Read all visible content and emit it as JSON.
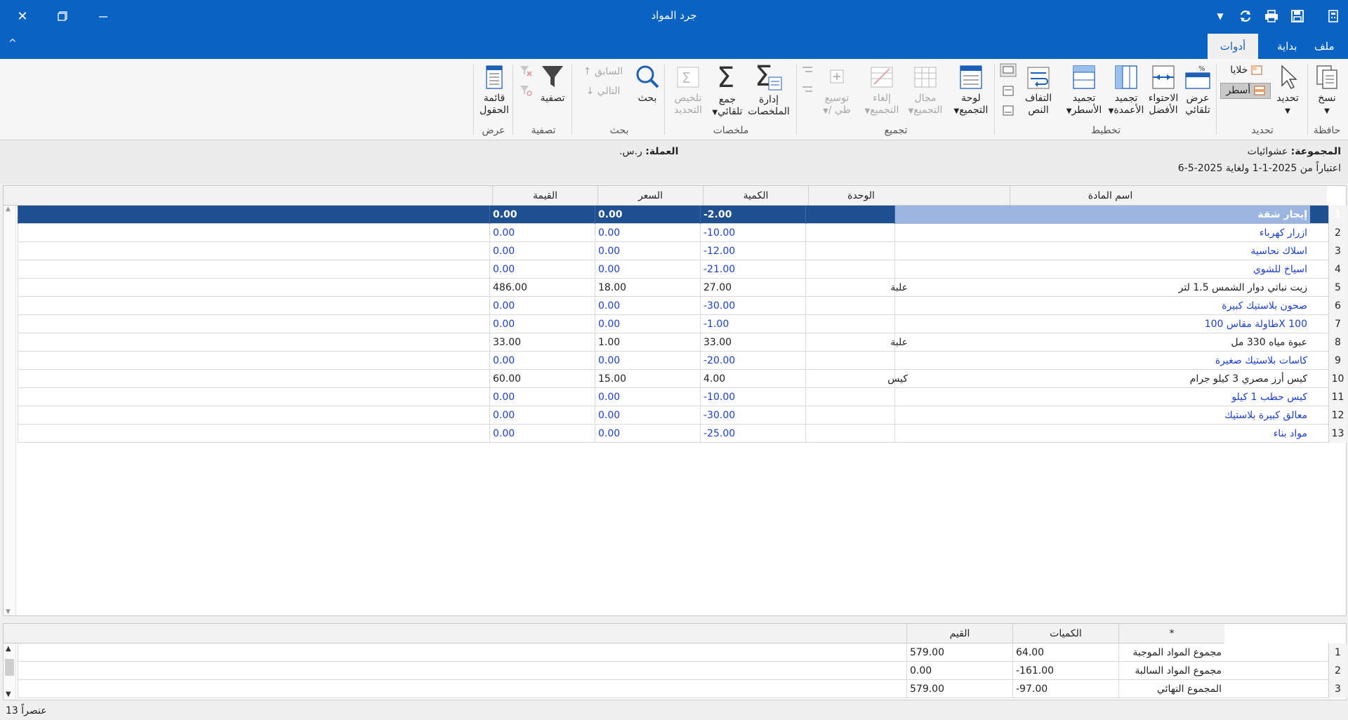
{
  "window": {
    "title": "جرد المواد"
  },
  "tabs": {
    "file": "ملف",
    "home": "بداية",
    "tools": "أدوات"
  },
  "ribbon": {
    "copy": "نسخ",
    "select": "تحديد",
    "cells": "خلايا",
    "rows": "أسطر",
    "auto_width_1": "عرض",
    "auto_width_2": "تلقائي",
    "best_fit_1": "الاحتواء",
    "best_fit_2": "الأفضل",
    "freeze_cols_1": "تجميد",
    "freeze_cols_2": "الأعمدة",
    "freeze_rows_1": "تجميد",
    "freeze_rows_2": "الأسطر",
    "wrap_1": "التفاف",
    "wrap_2": "النص",
    "group_panel_1": "لوحة",
    "group_panel_2": "التجميع",
    "group_range_1": "مجال",
    "group_range_2": "التجميع",
    "ungroup_1": "إلغاء",
    "ungroup_2": "التجميع",
    "expand_1": "توسيع",
    "expand_2": "/ طي",
    "manage_summaries_1": "إدارة",
    "manage_summaries_2": "الملخصات",
    "auto_sum_1": "جمع",
    "auto_sum_2": "تلقائي",
    "summarize_sel_1": "تلخيص",
    "summarize_sel_2": "التحديد",
    "search": "بحث",
    "previous": "السابق",
    "next": "التالي",
    "filter": "تصفية",
    "field_list_1": "قائمة",
    "field_list_2": "الحقول",
    "groups": {
      "clipboard": "حافظة",
      "selection": "تحديد",
      "layout": "تخطيط",
      "grouping": "تجميع",
      "summaries": "ملخصات",
      "search": "بحث",
      "filter": "تصفية",
      "view": "عرض"
    }
  },
  "info": {
    "group_label": "المجموعة:",
    "group_value": "عشوائيات",
    "currency_label": "العملة:",
    "currency_value": "ر.س.",
    "date_range": "اعتباراً من  2025-1-1 ولغاية  2025-5-6"
  },
  "grid": {
    "headers": {
      "name": "اسم المادة",
      "unit": "الوحدة",
      "qty": "الكمية",
      "price": "السعر",
      "value": "القيمة"
    },
    "rows": [
      {
        "n": "1",
        "name": "إيجار شقة",
        "unit": "",
        "qty": "-2.00",
        "price": "0.00",
        "value": "0.00",
        "blue": true
      },
      {
        "n": "2",
        "name": "ازرار كهرباء",
        "unit": "",
        "qty": "-10.00",
        "price": "0.00",
        "value": "0.00",
        "blue": true
      },
      {
        "n": "3",
        "name": "اسلاك نحاسية",
        "unit": "",
        "qty": "-12.00",
        "price": "0.00",
        "value": "0.00",
        "blue": true
      },
      {
        "n": "4",
        "name": "اسياخ للشوي",
        "unit": "",
        "qty": "-21.00",
        "price": "0.00",
        "value": "0.00",
        "blue": true
      },
      {
        "n": "5",
        "name": "زيت نباتي دوار الشمس 1.5 لتر",
        "unit": "علبة",
        "qty": "27.00",
        "price": "18.00",
        "value": "486.00",
        "blue": false
      },
      {
        "n": "6",
        "name": "صحون بلاستيك كبيرة",
        "unit": "",
        "qty": "-30.00",
        "price": "0.00",
        "value": "0.00",
        "blue": true
      },
      {
        "n": "7",
        "name": "طاولة مقاس 100X 100",
        "unit": "",
        "qty": "-1.00",
        "price": "0.00",
        "value": "0.00",
        "blue": true
      },
      {
        "n": "8",
        "name": "عبوة مياه 330 مل",
        "unit": "علبة",
        "qty": "33.00",
        "price": "1.00",
        "value": "33.00",
        "blue": false
      },
      {
        "n": "9",
        "name": "كاسات بلاستيك صغيرة",
        "unit": "",
        "qty": "-20.00",
        "price": "0.00",
        "value": "0.00",
        "blue": true
      },
      {
        "n": "10",
        "name": "كيس أرز مصري 3 كيلو جرام",
        "unit": "كيس",
        "qty": "4.00",
        "price": "15.00",
        "value": "60.00",
        "blue": false
      },
      {
        "n": "11",
        "name": "كيس حطب 1 كيلو",
        "unit": "",
        "qty": "-10.00",
        "price": "0.00",
        "value": "0.00",
        "blue": true
      },
      {
        "n": "12",
        "name": "معالق كبيرة بلاستيك",
        "unit": "",
        "qty": "-30.00",
        "price": "0.00",
        "value": "0.00",
        "blue": true
      },
      {
        "n": "13",
        "name": "مواد بناء",
        "unit": "",
        "qty": "-25.00",
        "price": "0.00",
        "value": "0.00",
        "blue": true
      }
    ]
  },
  "summary": {
    "headers": {
      "star": "*",
      "quantities": "الكميات",
      "values": "القيم"
    },
    "rows": [
      {
        "n": "1",
        "label": "مجموع المواد الموجبة",
        "qty": "64.00",
        "value": "579.00"
      },
      {
        "n": "2",
        "label": "مجموع المواد السالبة",
        "qty": "-161.00",
        "value": "0.00"
      },
      {
        "n": "3",
        "label": "المجموع النهائي",
        "qty": "-97.00",
        "value": "579.00"
      }
    ]
  },
  "status": {
    "count": "13 عنصراً"
  },
  "colors": {
    "titlebar": "#0a63c2",
    "selected_row": "#1d4f91",
    "negative_text": "#1c3fd6"
  }
}
